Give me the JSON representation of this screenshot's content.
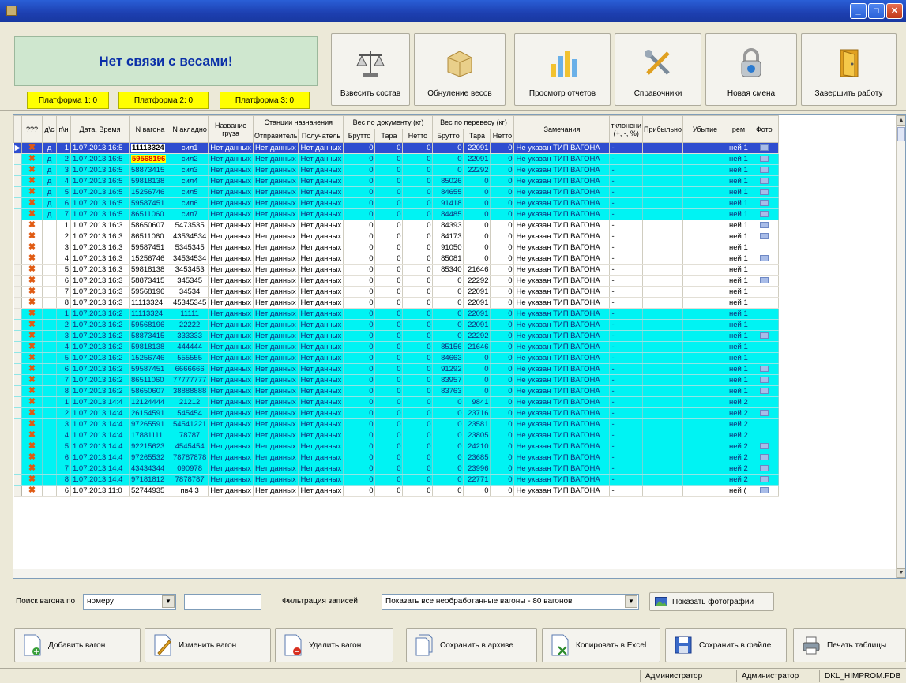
{
  "window": {
    "close_label": "✕",
    "maximize_label": "□",
    "minimize_label": "_"
  },
  "scale_status": "Нет связи с весами!",
  "platforms": [
    "Платформа 1: 0",
    "Платформа 2: 0",
    "Платформа 3: 0"
  ],
  "toolbar": [
    {
      "label": "Взвесить состав",
      "icon": "scales-icon"
    },
    {
      "label": "Обнуление весов",
      "icon": "box-icon"
    },
    {
      "label": "Просмотр отчетов",
      "icon": "reports-icon"
    },
    {
      "label": "Справочники",
      "icon": "tools-icon"
    },
    {
      "label": "Новая смена",
      "icon": "lock-icon"
    },
    {
      "label": "Завершить работу",
      "icon": "door-icon"
    }
  ],
  "columns": {
    "q": "???",
    "d": "д\\с",
    "n": "п\\н",
    "date": "Дата, Время",
    "wagon": "N вагона",
    "nakl": "N акладно",
    "cargo": "Название груза",
    "stations": "Станции назначения",
    "sender": "Отправитель",
    "receiver": "Получатель",
    "docw": "Вес по документу (кг)",
    "reweigh": "Вес по перевесу (кг)",
    "brutto": "Брутто",
    "tara": "Тара",
    "netto": "Нетто",
    "notes": "Замечания",
    "dev": "тклонени (+, -, %)",
    "profit": "Прибыльно",
    "loss": "Убытие",
    "rem": "рем",
    "foto": "Фото"
  },
  "rows": [
    {
      "q": "✖",
      "d": "д",
      "n": "1",
      "date": "1.07.2013 16:5",
      "wagon": "11113324",
      "nakl": "сил1",
      "cargo": "Нет данных",
      "snd": "Нет данных",
      "rcv": "Нет данных",
      "db": "0",
      "dt": "0",
      "dn": "0",
      "rb": "0",
      "rt": "22091",
      "rn": "0",
      "note": "Не указан ТИП ВАГОНА",
      "dev": "-",
      "rem": "ней 1",
      "foto": true,
      "style": "sel",
      "whl": "hl"
    },
    {
      "q": "✖",
      "d": "д",
      "n": "2",
      "date": "1.07.2013 16:5",
      "wagon": "59568196",
      "nakl": "сил2",
      "cargo": "Нет данных",
      "snd": "Нет данных",
      "rcv": "Нет данных",
      "db": "0",
      "dt": "0",
      "dn": "0",
      "rb": "0",
      "rt": "22091",
      "rn": "0",
      "note": "Не указан ТИП ВАГОНА",
      "dev": "-",
      "rem": "ней 1",
      "foto": true,
      "style": "cyan",
      "whl": "hl-red"
    },
    {
      "q": "✖",
      "d": "д",
      "n": "3",
      "date": "1.07.2013 16:5",
      "wagon": "58873415",
      "nakl": "сил3",
      "cargo": "Нет данных",
      "snd": "Нет данных",
      "rcv": "Нет данных",
      "db": "0",
      "dt": "0",
      "dn": "0",
      "rb": "0",
      "rt": "22292",
      "rn": "0",
      "note": "Не указан ТИП ВАГОНА",
      "dev": "-",
      "rem": "ней 1",
      "foto": true,
      "style": "cyan"
    },
    {
      "q": "✖",
      "d": "д",
      "n": "4",
      "date": "1.07.2013 16:5",
      "wagon": "59818138",
      "nakl": "сил4",
      "cargo": "Нет данных",
      "snd": "Нет данных",
      "rcv": "Нет данных",
      "db": "0",
      "dt": "0",
      "dn": "0",
      "rb": "85026",
      "rt": "0",
      "rn": "0",
      "note": "Не указан ТИП ВАГОНА",
      "dev": "-",
      "rem": "ней 1",
      "foto": true,
      "style": "cyan"
    },
    {
      "q": "✖",
      "d": "д",
      "n": "5",
      "date": "1.07.2013 16:5",
      "wagon": "15256746",
      "nakl": "сил5",
      "cargo": "Нет данных",
      "snd": "Нет данных",
      "rcv": "Нет данных",
      "db": "0",
      "dt": "0",
      "dn": "0",
      "rb": "84655",
      "rt": "0",
      "rn": "0",
      "note": "Не указан ТИП ВАГОНА",
      "dev": "-",
      "rem": "ней 1",
      "foto": true,
      "style": "cyan"
    },
    {
      "q": "✖",
      "d": "д",
      "n": "6",
      "date": "1.07.2013 16:5",
      "wagon": "59587451",
      "nakl": "сил6",
      "cargo": "Нет данных",
      "snd": "Нет данных",
      "rcv": "Нет данных",
      "db": "0",
      "dt": "0",
      "dn": "0",
      "rb": "91418",
      "rt": "0",
      "rn": "0",
      "note": "Не указан ТИП ВАГОНА",
      "dev": "-",
      "rem": "ней 1",
      "foto": true,
      "style": "cyan"
    },
    {
      "q": "✖",
      "d": "д",
      "n": "7",
      "date": "1.07.2013 16:5",
      "wagon": "86511060",
      "nakl": "сил7",
      "cargo": "Нет данных",
      "snd": "Нет данных",
      "rcv": "Нет данных",
      "db": "0",
      "dt": "0",
      "dn": "0",
      "rb": "84485",
      "rt": "0",
      "rn": "0",
      "note": "Не указан ТИП ВАГОНА",
      "dev": "-",
      "rem": "ней 1",
      "foto": true,
      "style": "cyan"
    },
    {
      "q": "✖",
      "d": "",
      "n": "1",
      "date": "1.07.2013 16:3",
      "wagon": "58650607",
      "nakl": "5473535",
      "cargo": "Нет данных",
      "snd": "Нет данных",
      "rcv": "Нет данных",
      "db": "0",
      "dt": "0",
      "dn": "0",
      "rb": "84393",
      "rt": "0",
      "rn": "0",
      "note": "Не указан ТИП ВАГОНА",
      "dev": "-",
      "rem": "ней 1",
      "foto": true,
      "style": "white"
    },
    {
      "q": "✖",
      "d": "",
      "n": "2",
      "date": "1.07.2013 16:3",
      "wagon": "86511060",
      "nakl": "43534534",
      "cargo": "Нет данных",
      "snd": "Нет данных",
      "rcv": "Нет данных",
      "db": "0",
      "dt": "0",
      "dn": "0",
      "rb": "84173",
      "rt": "0",
      "rn": "0",
      "note": "Не указан ТИП ВАГОНА",
      "dev": "-",
      "rem": "ней 1",
      "foto": true,
      "style": "white"
    },
    {
      "q": "✖",
      "d": "",
      "n": "3",
      "date": "1.07.2013 16:3",
      "wagon": "59587451",
      "nakl": "5345345",
      "cargo": "Нет данных",
      "snd": "Нет данных",
      "rcv": "Нет данных",
      "db": "0",
      "dt": "0",
      "dn": "0",
      "rb": "91050",
      "rt": "0",
      "rn": "0",
      "note": "Не указан ТИП ВАГОНА",
      "dev": "-",
      "rem": "ней 1",
      "foto": false,
      "style": "white"
    },
    {
      "q": "✖",
      "d": "",
      "n": "4",
      "date": "1.07.2013 16:3",
      "wagon": "15256746",
      "nakl": "34534534",
      "cargo": "Нет данных",
      "snd": "Нет данных",
      "rcv": "Нет данных",
      "db": "0",
      "dt": "0",
      "dn": "0",
      "rb": "85081",
      "rt": "0",
      "rn": "0",
      "note": "Не указан ТИП ВАГОНА",
      "dev": "-",
      "rem": "ней 1",
      "foto": true,
      "style": "white"
    },
    {
      "q": "✖",
      "d": "",
      "n": "5",
      "date": "1.07.2013 16:3",
      "wagon": "59818138",
      "nakl": "3453453",
      "cargo": "Нет данных",
      "snd": "Нет данных",
      "rcv": "Нет данных",
      "db": "0",
      "dt": "0",
      "dn": "0",
      "rb": "85340",
      "rt": "21646",
      "rn": "0",
      "note": "Не указан ТИП ВАГОНА",
      "dev": "-",
      "rem": "ней 1",
      "foto": false,
      "style": "white"
    },
    {
      "q": "✖",
      "d": "",
      "n": "6",
      "date": "1.07.2013 16:3",
      "wagon": "58873415",
      "nakl": "345345",
      "cargo": "Нет данных",
      "snd": "Нет данных",
      "rcv": "Нет данных",
      "db": "0",
      "dt": "0",
      "dn": "0",
      "rb": "0",
      "rt": "22292",
      "rn": "0",
      "note": "Не указан ТИП ВАГОНА",
      "dev": "-",
      "rem": "ней 1",
      "foto": true,
      "style": "white"
    },
    {
      "q": "✖",
      "d": "",
      "n": "7",
      "date": "1.07.2013 16:3",
      "wagon": "59568196",
      "nakl": "34534",
      "cargo": "Нет данных",
      "snd": "Нет данных",
      "rcv": "Нет данных",
      "db": "0",
      "dt": "0",
      "dn": "0",
      "rb": "0",
      "rt": "22091",
      "rn": "0",
      "note": "Не указан ТИП ВАГОНА",
      "dev": "-",
      "rem": "ней 1",
      "foto": false,
      "style": "white"
    },
    {
      "q": "✖",
      "d": "",
      "n": "8",
      "date": "1.07.2013 16:3",
      "wagon": "11113324",
      "nakl": "45345345",
      "cargo": "Нет данных",
      "snd": "Нет данных",
      "rcv": "Нет данных",
      "db": "0",
      "dt": "0",
      "dn": "0",
      "rb": "0",
      "rt": "22091",
      "rn": "0",
      "note": "Не указан ТИП ВАГОНА",
      "dev": "-",
      "rem": "ней 1",
      "foto": false,
      "style": "white"
    },
    {
      "q": "✖",
      "d": "",
      "n": "1",
      "date": "1.07.2013 16:2",
      "wagon": "11113324",
      "nakl": "11111",
      "cargo": "Нет данных",
      "snd": "Нет данных",
      "rcv": "Нет данных",
      "db": "0",
      "dt": "0",
      "dn": "0",
      "rb": "0",
      "rt": "22091",
      "rn": "0",
      "note": "Не указан ТИП ВАГОНА",
      "dev": "-",
      "rem": "ней 1",
      "foto": false,
      "style": "cyan"
    },
    {
      "q": "✖",
      "d": "",
      "n": "2",
      "date": "1.07.2013 16:2",
      "wagon": "59568196",
      "nakl": "22222",
      "cargo": "Нет данных",
      "snd": "Нет данных",
      "rcv": "Нет данных",
      "db": "0",
      "dt": "0",
      "dn": "0",
      "rb": "0",
      "rt": "22091",
      "rn": "0",
      "note": "Не указан ТИП ВАГОНА",
      "dev": "-",
      "rem": "ней 1",
      "foto": false,
      "style": "cyan"
    },
    {
      "q": "✖",
      "d": "",
      "n": "3",
      "date": "1.07.2013 16:2",
      "wagon": "58873415",
      "nakl": "333333",
      "cargo": "Нет данных",
      "snd": "Нет данных",
      "rcv": "Нет данных",
      "db": "0",
      "dt": "0",
      "dn": "0",
      "rb": "0",
      "rt": "22292",
      "rn": "0",
      "note": "Не указан ТИП ВАГОНА",
      "dev": "-",
      "rem": "ней 1",
      "foto": true,
      "style": "cyan"
    },
    {
      "q": "✖",
      "d": "",
      "n": "4",
      "date": "1.07.2013 16:2",
      "wagon": "59818138",
      "nakl": "444444",
      "cargo": "Нет данных",
      "snd": "Нет данных",
      "rcv": "Нет данных",
      "db": "0",
      "dt": "0",
      "dn": "0",
      "rb": "85156",
      "rt": "21646",
      "rn": "0",
      "note": "Не указан ТИП ВАГОНА",
      "dev": "-",
      "rem": "ней 1",
      "foto": false,
      "style": "cyan"
    },
    {
      "q": "✖",
      "d": "",
      "n": "5",
      "date": "1.07.2013 16:2",
      "wagon": "15256746",
      "nakl": "555555",
      "cargo": "Нет данных",
      "snd": "Нет данных",
      "rcv": "Нет данных",
      "db": "0",
      "dt": "0",
      "dn": "0",
      "rb": "84663",
      "rt": "0",
      "rn": "0",
      "note": "Не указан ТИП ВАГОНА",
      "dev": "-",
      "rem": "ней 1",
      "foto": false,
      "style": "cyan"
    },
    {
      "q": "✖",
      "d": "",
      "n": "6",
      "date": "1.07.2013 16:2",
      "wagon": "59587451",
      "nakl": "6666666",
      "cargo": "Нет данных",
      "snd": "Нет данных",
      "rcv": "Нет данных",
      "db": "0",
      "dt": "0",
      "dn": "0",
      "rb": "91292",
      "rt": "0",
      "rn": "0",
      "note": "Не указан ТИП ВАГОНА",
      "dev": "-",
      "rem": "ней 1",
      "foto": true,
      "style": "cyan"
    },
    {
      "q": "✖",
      "d": "",
      "n": "7",
      "date": "1.07.2013 16:2",
      "wagon": "86511060",
      "nakl": "77777777",
      "cargo": "Нет данных",
      "snd": "Нет данных",
      "rcv": "Нет данных",
      "db": "0",
      "dt": "0",
      "dn": "0",
      "rb": "83957",
      "rt": "0",
      "rn": "0",
      "note": "Не указан ТИП ВАГОНА",
      "dev": "-",
      "rem": "ней 1",
      "foto": true,
      "style": "cyan"
    },
    {
      "q": "✖",
      "d": "",
      "n": "8",
      "date": "1.07.2013 16:2",
      "wagon": "58650607",
      "nakl": "38888888",
      "cargo": "Нет данных",
      "snd": "Нет данных",
      "rcv": "Нет данных",
      "db": "0",
      "dt": "0",
      "dn": "0",
      "rb": "83763",
      "rt": "0",
      "rn": "0",
      "note": "Не указан ТИП ВАГОНА",
      "dev": "-",
      "rem": "ней 1",
      "foto": true,
      "style": "cyan"
    },
    {
      "q": "✖",
      "d": "",
      "n": "1",
      "date": "1.07.2013 14:4",
      "wagon": "12124444",
      "nakl": "21212",
      "cargo": "Нет данных",
      "snd": "Нет данных",
      "rcv": "Нет данных",
      "db": "0",
      "dt": "0",
      "dn": "0",
      "rb": "0",
      "rt": "9841",
      "rn": "0",
      "note": "Не указан ТИП ВАГОНА",
      "dev": "-",
      "rem": "ней 2",
      "foto": false,
      "style": "cyan"
    },
    {
      "q": "✖",
      "d": "",
      "n": "2",
      "date": "1.07.2013 14:4",
      "wagon": "26154591",
      "nakl": "545454",
      "cargo": "Нет данных",
      "snd": "Нет данных",
      "rcv": "Нет данных",
      "db": "0",
      "dt": "0",
      "dn": "0",
      "rb": "0",
      "rt": "23716",
      "rn": "0",
      "note": "Не указан ТИП ВАГОНА",
      "dev": "-",
      "rem": "ней 2",
      "foto": true,
      "style": "cyan"
    },
    {
      "q": "✖",
      "d": "",
      "n": "3",
      "date": "1.07.2013 14:4",
      "wagon": "97265591",
      "nakl": "54541221",
      "cargo": "Нет данных",
      "snd": "Нет данных",
      "rcv": "Нет данных",
      "db": "0",
      "dt": "0",
      "dn": "0",
      "rb": "0",
      "rt": "23581",
      "rn": "0",
      "note": "Не указан ТИП ВАГОНА",
      "dev": "-",
      "rem": "ней 2",
      "foto": false,
      "style": "cyan"
    },
    {
      "q": "✖",
      "d": "",
      "n": "4",
      "date": "1.07.2013 14:4",
      "wagon": "17881111",
      "nakl": "78787",
      "cargo": "Нет данных",
      "snd": "Нет данных",
      "rcv": "Нет данных",
      "db": "0",
      "dt": "0",
      "dn": "0",
      "rb": "0",
      "rt": "23805",
      "rn": "0",
      "note": "Не указан ТИП ВАГОНА",
      "dev": "-",
      "rem": "ней 2",
      "foto": false,
      "style": "cyan"
    },
    {
      "q": "✖",
      "d": "",
      "n": "5",
      "date": "1.07.2013 14:4",
      "wagon": "92215623",
      "nakl": "4545454",
      "cargo": "Нет данных",
      "snd": "Нет данных",
      "rcv": "Нет данных",
      "db": "0",
      "dt": "0",
      "dn": "0",
      "rb": "0",
      "rt": "24210",
      "rn": "0",
      "note": "Не указан ТИП ВАГОНА",
      "dev": "-",
      "rem": "ней 2",
      "foto": true,
      "style": "cyan"
    },
    {
      "q": "✖",
      "d": "",
      "n": "6",
      "date": "1.07.2013 14:4",
      "wagon": "97265532",
      "nakl": "78787878",
      "cargo": "Нет данных",
      "snd": "Нет данных",
      "rcv": "Нет данных",
      "db": "0",
      "dt": "0",
      "dn": "0",
      "rb": "0",
      "rt": "23685",
      "rn": "0",
      "note": "Не указан ТИП ВАГОНА",
      "dev": "-",
      "rem": "ней 2",
      "foto": true,
      "style": "cyan"
    },
    {
      "q": "✖",
      "d": "",
      "n": "7",
      "date": "1.07.2013 14:4",
      "wagon": "43434344",
      "nakl": "090978",
      "cargo": "Нет данных",
      "snd": "Нет данных",
      "rcv": "Нет данных",
      "db": "0",
      "dt": "0",
      "dn": "0",
      "rb": "0",
      "rt": "23996",
      "rn": "0",
      "note": "Не указан ТИП ВАГОНА",
      "dev": "-",
      "rem": "ней 2",
      "foto": true,
      "style": "cyan"
    },
    {
      "q": "✖",
      "d": "",
      "n": "8",
      "date": "1.07.2013 14:4",
      "wagon": "97181812",
      "nakl": "7878787",
      "cargo": "Нет данных",
      "snd": "Нет данных",
      "rcv": "Нет данных",
      "db": "0",
      "dt": "0",
      "dn": "0",
      "rb": "0",
      "rt": "22771",
      "rn": "0",
      "note": "Не указан ТИП ВАГОНА",
      "dev": "-",
      "rem": "ней 2",
      "foto": true,
      "style": "cyan"
    },
    {
      "q": "✖",
      "d": "",
      "n": "6",
      "date": "1.07.2013 11:0",
      "wagon": "52744935",
      "nakl": "пв4 3",
      "cargo": "Нет данных",
      "snd": "Нет данных",
      "rcv": "Нет данных",
      "db": "0",
      "dt": "0",
      "dn": "0",
      "rb": "0",
      "rt": "0",
      "rn": "0",
      "note": "Не указан ТИП ВАГОНА",
      "dev": "-",
      "rem": "ней (",
      "foto": true,
      "style": "white"
    }
  ],
  "search": {
    "label": "Поиск вагона по",
    "by_value": "номеру",
    "text_value": "",
    "filter_label": "Фильтрация записей",
    "filter_value": "Показать все необработанные вагоны - 80 вагонов",
    "show_photos": "Показать фотографии"
  },
  "actions": [
    "Добавить вагон",
    "Изменить вагон",
    "Удалить вагон",
    "Сохранить в архиве",
    "Копировать в Excel",
    "Сохранить в файле",
    "Печать таблицы"
  ],
  "status": [
    "Администратор",
    "Администратор",
    "DKL_HIMPROM.FDB"
  ],
  "colors": {
    "row_highlight": "#00f3f3",
    "selected_row": "#2e4dd0",
    "warning_yellow": "#ffff00",
    "x_mark": "#e05a12"
  }
}
